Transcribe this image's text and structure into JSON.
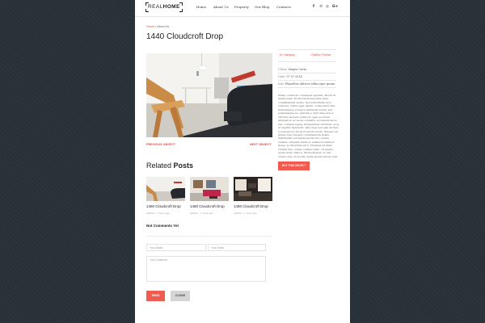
{
  "header": {
    "logo_light": "REAL",
    "logo_bold": "HOME",
    "nav": [
      "Home",
      "About Us",
      "Property",
      "Our Blog",
      "Contacts"
    ],
    "social_icons": [
      "facebook-icon",
      "pinterest-icon",
      "instagram-icon",
      "google-plus-icon"
    ]
  },
  "breadcrumb": {
    "home": "Home",
    "separator": "»",
    "current": "About Us"
  },
  "title": "1440 Cloudcroft Drop",
  "pager": {
    "prev": "PREVIOUS OBJECT",
    "next": "NEXT OBJECT"
  },
  "sidebar": {
    "category": "In Category",
    "gallery": "Gallery Format",
    "client_label": "Client:",
    "client": "Magna Carta",
    "date_label": "Date:",
    "date": "07.07.2014",
    "info_label": "Info:",
    "info": "Phasellus ultrices tellus eget ipsum",
    "description": "Etiam commodo consequat egestas. Morbi ut ligula nulla. Morbi bibendum ante vitae condimentum mollis. Sed sollicitudin eros vehicula, varius eget ipsum, consectetur nisi. Pellentesque posuere dignissim lorem, sed pellentesque leo gravida a. Sed vitae eros a ultricies laoreet commodo eget eu lorem. Aliquam ac ac lacus convallis, accumsan lacus sed, volutpat ligula. Suspendisse tincidunt, eros ut sagittis hendrerit, felis risus sed sem dictum, a posuere leo lacus id ipsum lorem. Integer vel ipsum nunc feugiat condimentum mollis. Vestibulum non ligula ipsum non cursus sodales. Aliquam tellus ac euismod euismod. Donec ac interdum arcu. Vivamus sit amet rutrum nisl, ornare sodales justo. Ut augue quam dolor, diam a. Morbi aliquet, ex nisi ornare nisi, ut iaculis, quam ipsum varius velit.",
    "buy": "BUY THIS OBJECT"
  },
  "related": {
    "heading_light": "Related",
    "heading_bold": "Posts",
    "posts": [
      {
        "title": "1450 Cloudcroft Drop",
        "meta": "Admin - 1 hour ago"
      },
      {
        "title": "1450 Cloudcroft Drop",
        "meta": "Admin - 1 hour ago"
      },
      {
        "title": "1450 Cloudcroft Drop",
        "meta": "Admin - 1 hour ago"
      }
    ]
  },
  "comments": {
    "heading": "Not Comments Yet",
    "name_placeholder": "Your Name",
    "email_placeholder": "Your Email",
    "comment_placeholder": "Your Comment",
    "send": "SEND",
    "clear": "CLEAR"
  },
  "colors": {
    "accent": "#f05a4f",
    "background": "#283138",
    "text": "#222222"
  }
}
